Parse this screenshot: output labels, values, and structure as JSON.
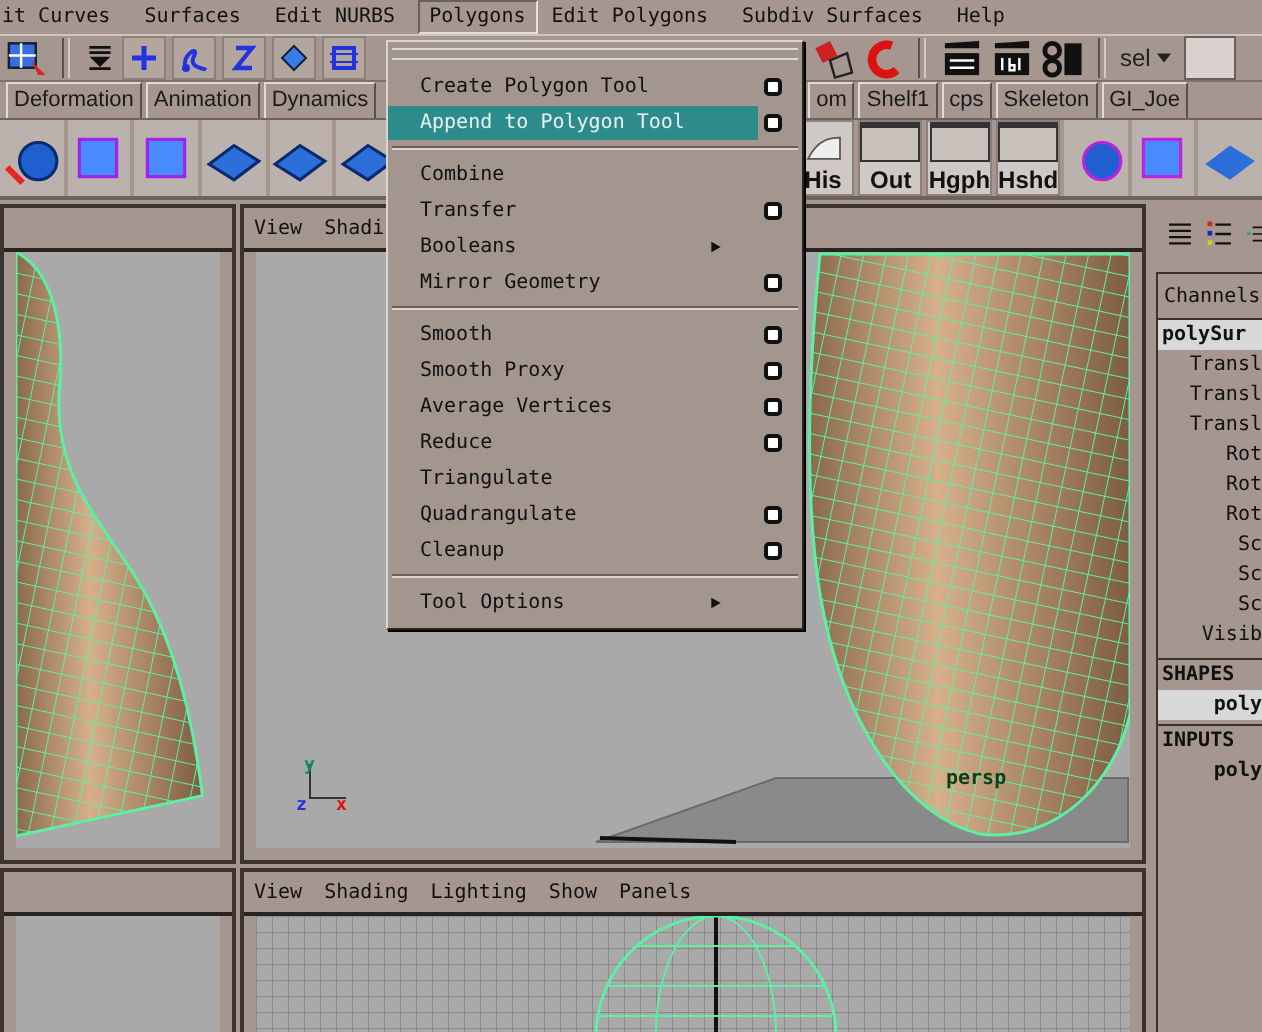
{
  "menu_bar": [
    {
      "label": "it Curves",
      "selected": false
    },
    {
      "label": "Surfaces",
      "selected": false
    },
    {
      "label": "Edit NURBS",
      "selected": false
    },
    {
      "label": "Polygons",
      "selected": true
    },
    {
      "label": "Edit Polygons",
      "selected": false
    },
    {
      "label": "Subdiv Surfaces",
      "selected": false
    },
    {
      "label": "Help",
      "selected": false
    }
  ],
  "toolbar": {
    "selection_field": "sel"
  },
  "shelf_tabs_left": [
    {
      "label": "Deformation",
      "selected": false
    },
    {
      "label": "Animation",
      "selected": false
    },
    {
      "label": "Dynamics",
      "selected": false
    }
  ],
  "shelf_tabs_right": [
    {
      "label": "om",
      "selected": false
    },
    {
      "label": "Shelf1",
      "selected": false
    },
    {
      "label": "cps",
      "selected": false
    },
    {
      "label": "Skeleton",
      "selected": false
    },
    {
      "label": "GI_Joe",
      "selected": false
    }
  ],
  "shelf_buttons": [
    {
      "label": "His",
      "kind": "curl"
    },
    {
      "label": "Out",
      "kind": "window"
    },
    {
      "label": "Hgph",
      "kind": "window"
    },
    {
      "label": "Hshd",
      "kind": "window"
    }
  ],
  "persp_viewport": {
    "menu": [
      "View",
      "Shadi"
    ],
    "camera_label": "persp",
    "axis_labels": {
      "y": "y",
      "z": "z",
      "x": "x"
    }
  },
  "bottom_viewport": {
    "menu": [
      "View",
      "Shading",
      "Lighting",
      "Show",
      "Panels"
    ]
  },
  "channel_box": {
    "tab": "Channels",
    "object": "polySur",
    "attributes": [
      "Transl",
      "Transl",
      "Transl",
      "Rot",
      "Rot",
      "Rot",
      "Sc",
      "Sc",
      "Sc",
      "Visib"
    ],
    "shapes_header": "SHAPES",
    "shape": "poly",
    "inputs_header": "INPUTS",
    "input": "poly"
  },
  "polygons_menu": {
    "groups": [
      [
        {
          "label": "Create Polygon Tool",
          "kind": "option",
          "selected": false
        },
        {
          "label": "Append to Polygon Tool",
          "kind": "option",
          "selected": true
        }
      ],
      [
        {
          "label": "Combine",
          "kind": "plain",
          "selected": false
        },
        {
          "label": "Transfer",
          "kind": "option",
          "selected": false
        },
        {
          "label": "Booleans",
          "kind": "submenu",
          "selected": false
        },
        {
          "label": "Mirror Geometry",
          "kind": "option",
          "selected": false
        }
      ],
      [
        {
          "label": "Smooth",
          "kind": "option",
          "selected": false
        },
        {
          "label": "Smooth Proxy",
          "kind": "option",
          "selected": false
        },
        {
          "label": "Average Vertices",
          "kind": "option",
          "selected": false
        },
        {
          "label": "Reduce",
          "kind": "option",
          "selected": false
        },
        {
          "label": "Triangulate",
          "kind": "plain",
          "selected": false
        },
        {
          "label": "Quadrangulate",
          "kind": "option",
          "selected": false
        },
        {
          "label": "Cleanup",
          "kind": "option",
          "selected": false
        }
      ],
      [
        {
          "label": "Tool Options",
          "kind": "submenu",
          "selected": false
        }
      ]
    ]
  }
}
